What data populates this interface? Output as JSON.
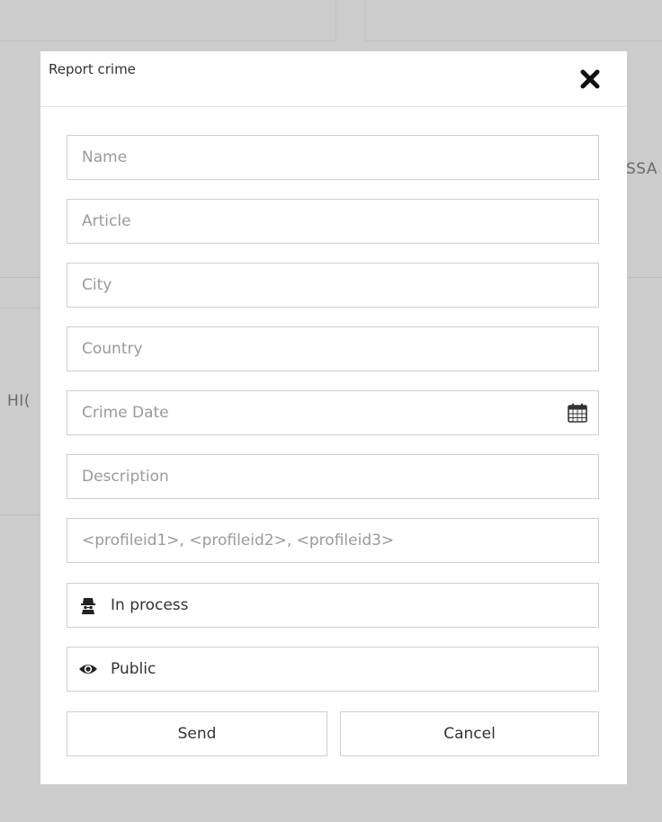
{
  "background": {
    "text_right": "SSA",
    "text_left": "HI("
  },
  "modal": {
    "title": "Report crime",
    "fields": {
      "name_placeholder": "Name",
      "article_placeholder": "Article",
      "city_placeholder": "City",
      "country_placeholder": "Country",
      "crime_date_placeholder": "Crime Date",
      "description_placeholder": "Description",
      "profiles_placeholder": "<profileid1>, <profileid2>, <profileid3>"
    },
    "status_select": {
      "value": "In process",
      "icon": "detective-icon"
    },
    "visibility_select": {
      "value": "Public",
      "icon": "eye-icon"
    },
    "buttons": {
      "send": "Send",
      "cancel": "Cancel"
    }
  },
  "colors": {
    "overlay": "#cccccc",
    "modal_bg": "#ffffff",
    "border": "#cfcfcf",
    "placeholder": "#9a9a9a"
  }
}
